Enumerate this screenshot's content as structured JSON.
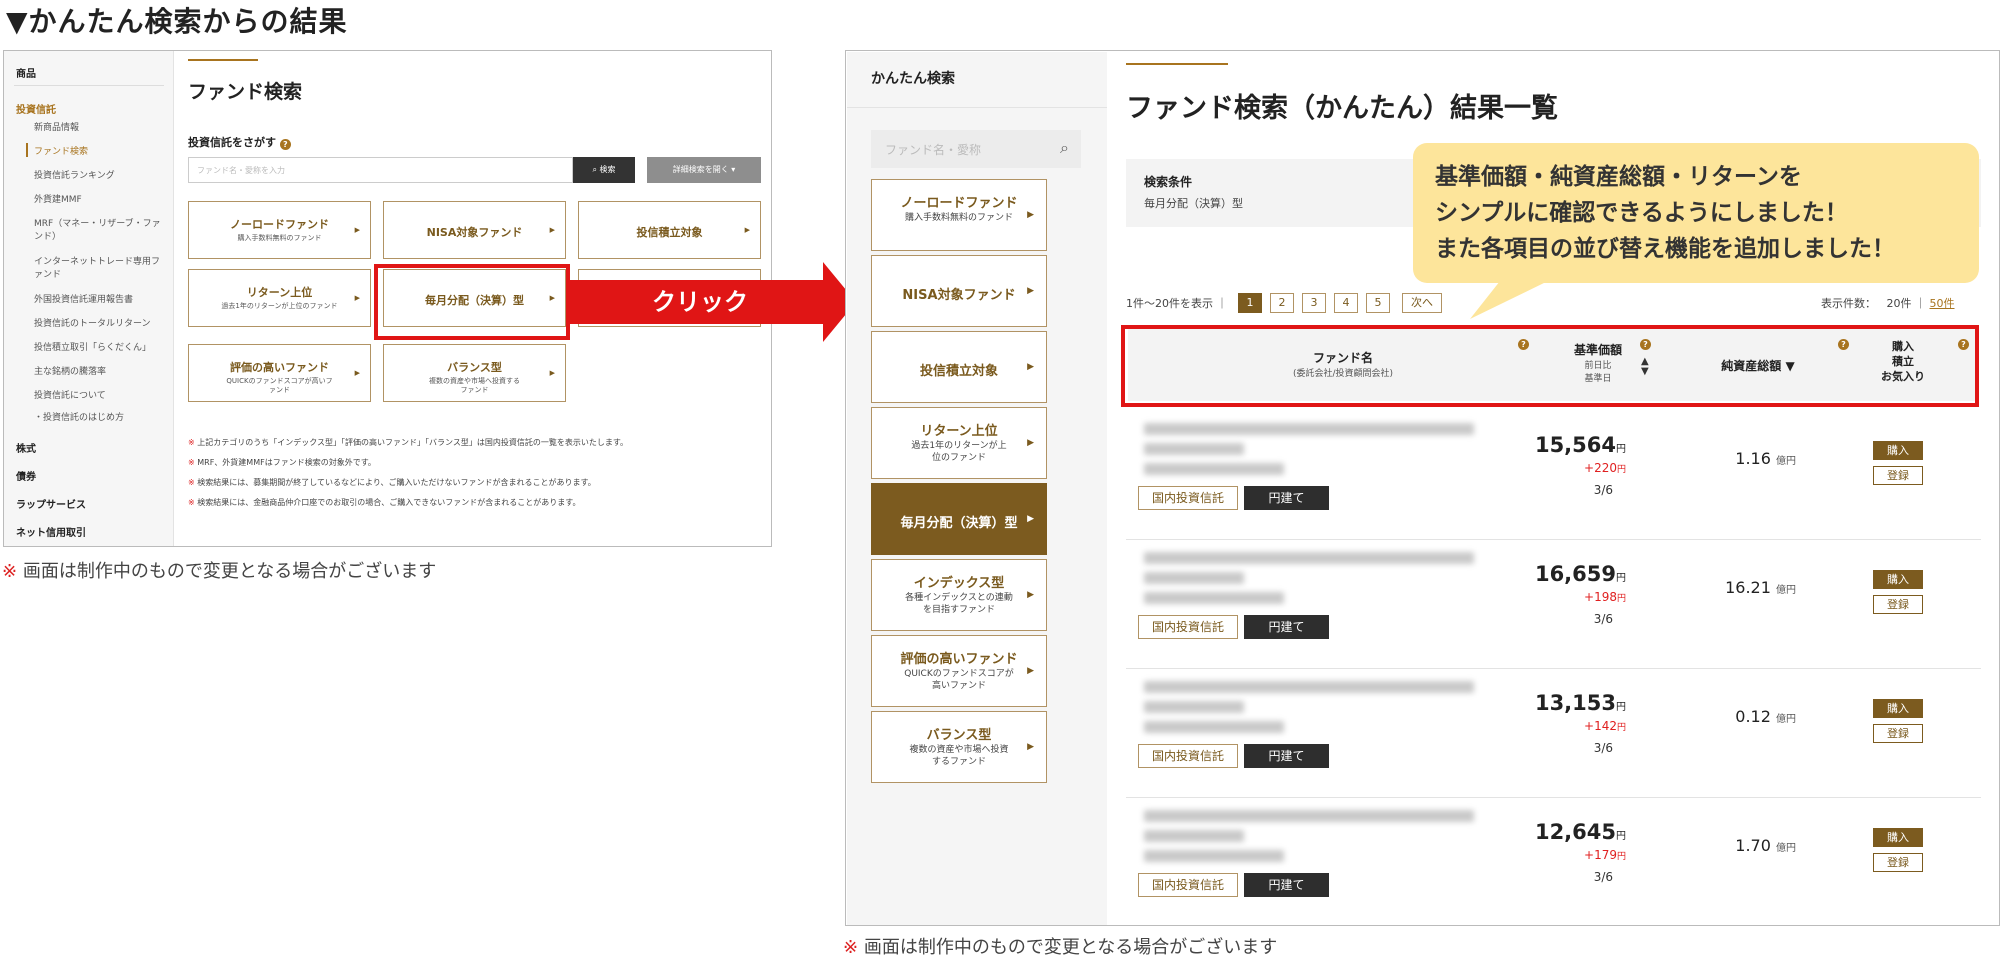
{
  "heading": "▼かんたん検索からの結果",
  "left": {
    "sidebar": {
      "cat_products": "商品",
      "cat_trust": "投資信託",
      "items": [
        "新商品情報",
        "ファンド検索",
        "投資信託ランキング",
        "外貨建MMF",
        "MRF（マネー・リザーブ・ファンド）",
        "インターネットトレード専用ファンド",
        "外国投資信託運用報告書",
        "投資信託のトータルリターン",
        "投信積立取引「らくだくん」",
        "主な銘柄の騰落率",
        "投資信託について",
        "・投資信託のはじめ方"
      ],
      "cats_bottom": [
        "株式",
        "債券",
        "ラップサービス",
        "ネット信用取引"
      ]
    },
    "title": "ファンド検索",
    "search_label": "投資信託をさがす",
    "search_placeholder": "ファンド名・愛称を入力",
    "search_button": "検索",
    "detail_button": "詳細検索を開く",
    "buttons": [
      {
        "title": "ノーロードファンド",
        "sub": "購入手数料無料のファンド"
      },
      {
        "title": "NISA対象ファンド",
        "sub": ""
      },
      {
        "title": "投信積立対象",
        "sub": ""
      },
      {
        "title": "リターン上位",
        "sub": "過去1年のリターンが上位のファンド"
      },
      {
        "title": "毎月分配（決算）型",
        "sub": ""
      },
      {
        "title": "評価の高いファンド",
        "sub": "QUICKのファンドスコアが高いファンド"
      },
      {
        "title": "バランス型",
        "sub": "複数の資産や市場へ投資するファンド"
      }
    ],
    "notes": [
      "上記カテゴリのうち「インデックス型」「評価の高いファンド」「バランス型」は国内投資信託の一覧を表示いたします。",
      "MRF、外貨建MMFはファンド検索の対象外です。",
      "検索結果には、募集期間が終了しているなどにより、ご購入いただけないファンドが含まれることがあります。",
      "検索結果には、金融商品仲介口座でのお取引の場合、ご購入できないファンドが含まれることがあります。"
    ],
    "note_mark": "※"
  },
  "click_label": "クリック",
  "note_mark": "※",
  "disclaimer": "画面は制作中のもので変更となる場合がございます",
  "right": {
    "sidebar": {
      "title": "かんたん検索",
      "search_placeholder": "ファンド名・愛称",
      "buttons": [
        {
          "title": "ノーロードファンド",
          "sub": "購入手数料無料のファンド"
        },
        {
          "title": "NISA対象ファンド",
          "sub": ""
        },
        {
          "title": "投信積立対象",
          "sub": ""
        },
        {
          "title": "リターン上位",
          "sub": "過去1年のリターンが上位のファンド"
        },
        {
          "title": "毎月分配（決算）型",
          "sub": ""
        },
        {
          "title": "インデックス型",
          "sub": "各種インデックスとの連動を目指すファンド"
        },
        {
          "title": "評価の高いファンド",
          "sub": "QUICKのファンドスコアが高いファンド"
        },
        {
          "title": "バランス型",
          "sub": "複数の資産や市場へ投資するファンド"
        }
      ]
    },
    "title": "ファンド検索（かんたん）結果一覧",
    "condition_label": "検索条件",
    "condition_value": "毎月分配（決算）型",
    "callout": [
      "基準価額・純資産総額・リターンを",
      "シンプルに確認できるようにしました！",
      "また各項目の並び替え機能を追加しました！"
    ],
    "count_text": "1件〜20件を表示",
    "pages": [
      "1",
      "2",
      "3",
      "4",
      "5",
      "次へ"
    ],
    "per_page_label": "表示件数：",
    "per_page_20": "20件",
    "per_page_50": "50件",
    "columns": {
      "fund_name": "ファンド名",
      "fund_sub": "(委託会社/投資顧問会社)",
      "nav": "基準価額",
      "nav_sub1": "前日比",
      "nav_sub2": "基準日",
      "assets": "純資産総額",
      "action1": "購入",
      "action2": "積立",
      "action3": "お気入り"
    },
    "rows": [
      {
        "price": "15,564",
        "change": "+220",
        "date": "3/6",
        "assets": "1.16"
      },
      {
        "price": "16,659",
        "change": "+198",
        "date": "3/6",
        "assets": "16.21"
      },
      {
        "price": "13,153",
        "change": "+142",
        "date": "3/6",
        "assets": "0.12"
      },
      {
        "price": "12,645",
        "change": "+179",
        "date": "3/6",
        "assets": "1.70"
      }
    ],
    "tag_domestic": "国内投資信託",
    "tag_yen": "円建て",
    "yen": "円",
    "oku_yen": "億円",
    "buy_label": "購入",
    "register_label": "登録"
  }
}
